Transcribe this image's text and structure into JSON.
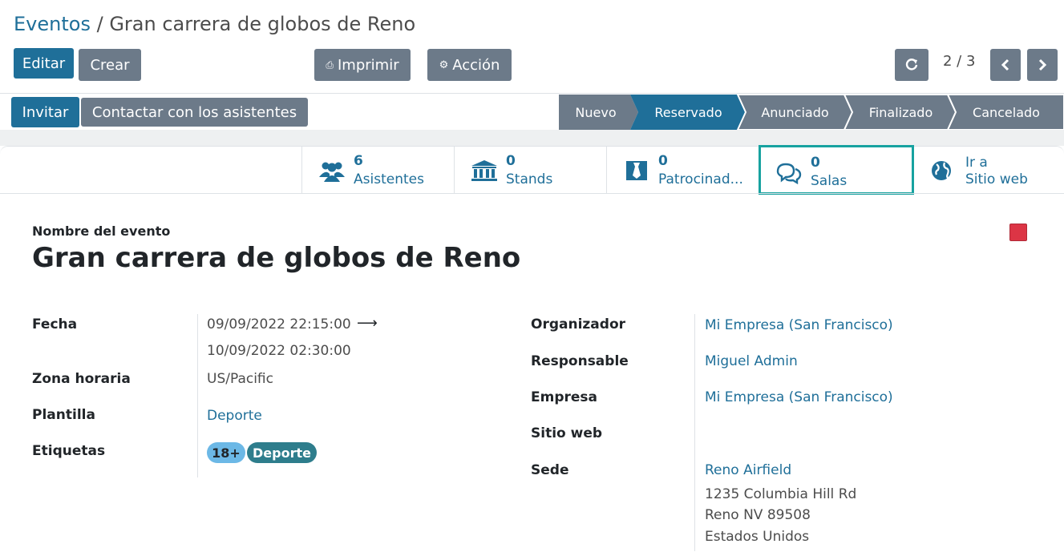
{
  "breadcrumb": {
    "parent": "Eventos",
    "separator": "/",
    "current": "Gran carrera de globos de Reno"
  },
  "toolbar": {
    "edit": "Editar",
    "create": "Crear",
    "print": "Imprimir",
    "action": "Acción",
    "pager": "2 / 3"
  },
  "header_buttons": {
    "invite": "Invitar",
    "contact": "Contactar con los asistentes"
  },
  "stages": [
    "Nuevo",
    "Reservado",
    "Anunciado",
    "Finalizado",
    "Cancelado"
  ],
  "active_stage": "Reservado",
  "smart_buttons": [
    {
      "count": "6",
      "label": "Asistentes",
      "icon": "users-icon"
    },
    {
      "count": "0",
      "label": "Stands",
      "icon": "bank-icon"
    },
    {
      "count": "0",
      "label": "Patrocinad...",
      "icon": "sponsor-icon"
    },
    {
      "count": "0",
      "label": "Salas",
      "icon": "chat-icon"
    },
    {
      "line1": "Ir a",
      "line2": "Sitio web",
      "icon": "globe-icon"
    }
  ],
  "form": {
    "name_label": "Nombre del evento",
    "name": "Gran carrera de globos de Reno",
    "left": {
      "fecha_label": "Fecha",
      "fecha_start": "09/09/2022 22:15:00",
      "fecha_end": "10/09/2022 02:30:00",
      "tz_label": "Zona horaria",
      "tz": "US/Pacific",
      "template_label": "Plantilla",
      "template": "Deporte",
      "tags_label": "Etiquetas",
      "tags": [
        "18+",
        "Deporte"
      ]
    },
    "right": {
      "organizer_label": "Organizador",
      "organizer": "Mi Empresa (San Francisco)",
      "responsible_label": "Responsable",
      "responsible": "Miguel Admin",
      "company_label": "Empresa",
      "company": "Mi Empresa (San Francisco)",
      "website_label": "Sitio web",
      "venue_label": "Sede",
      "venue": "Reno Airfield",
      "address1": "1235 Columbia Hill Rd",
      "address2": "Reno NV 89508",
      "address3": "Estados Unidos"
    }
  },
  "colors": {
    "primary": "#1f6f99",
    "secondary": "#6c7a89",
    "highlight": "#17a2a0",
    "color_square": "#dc3545"
  }
}
